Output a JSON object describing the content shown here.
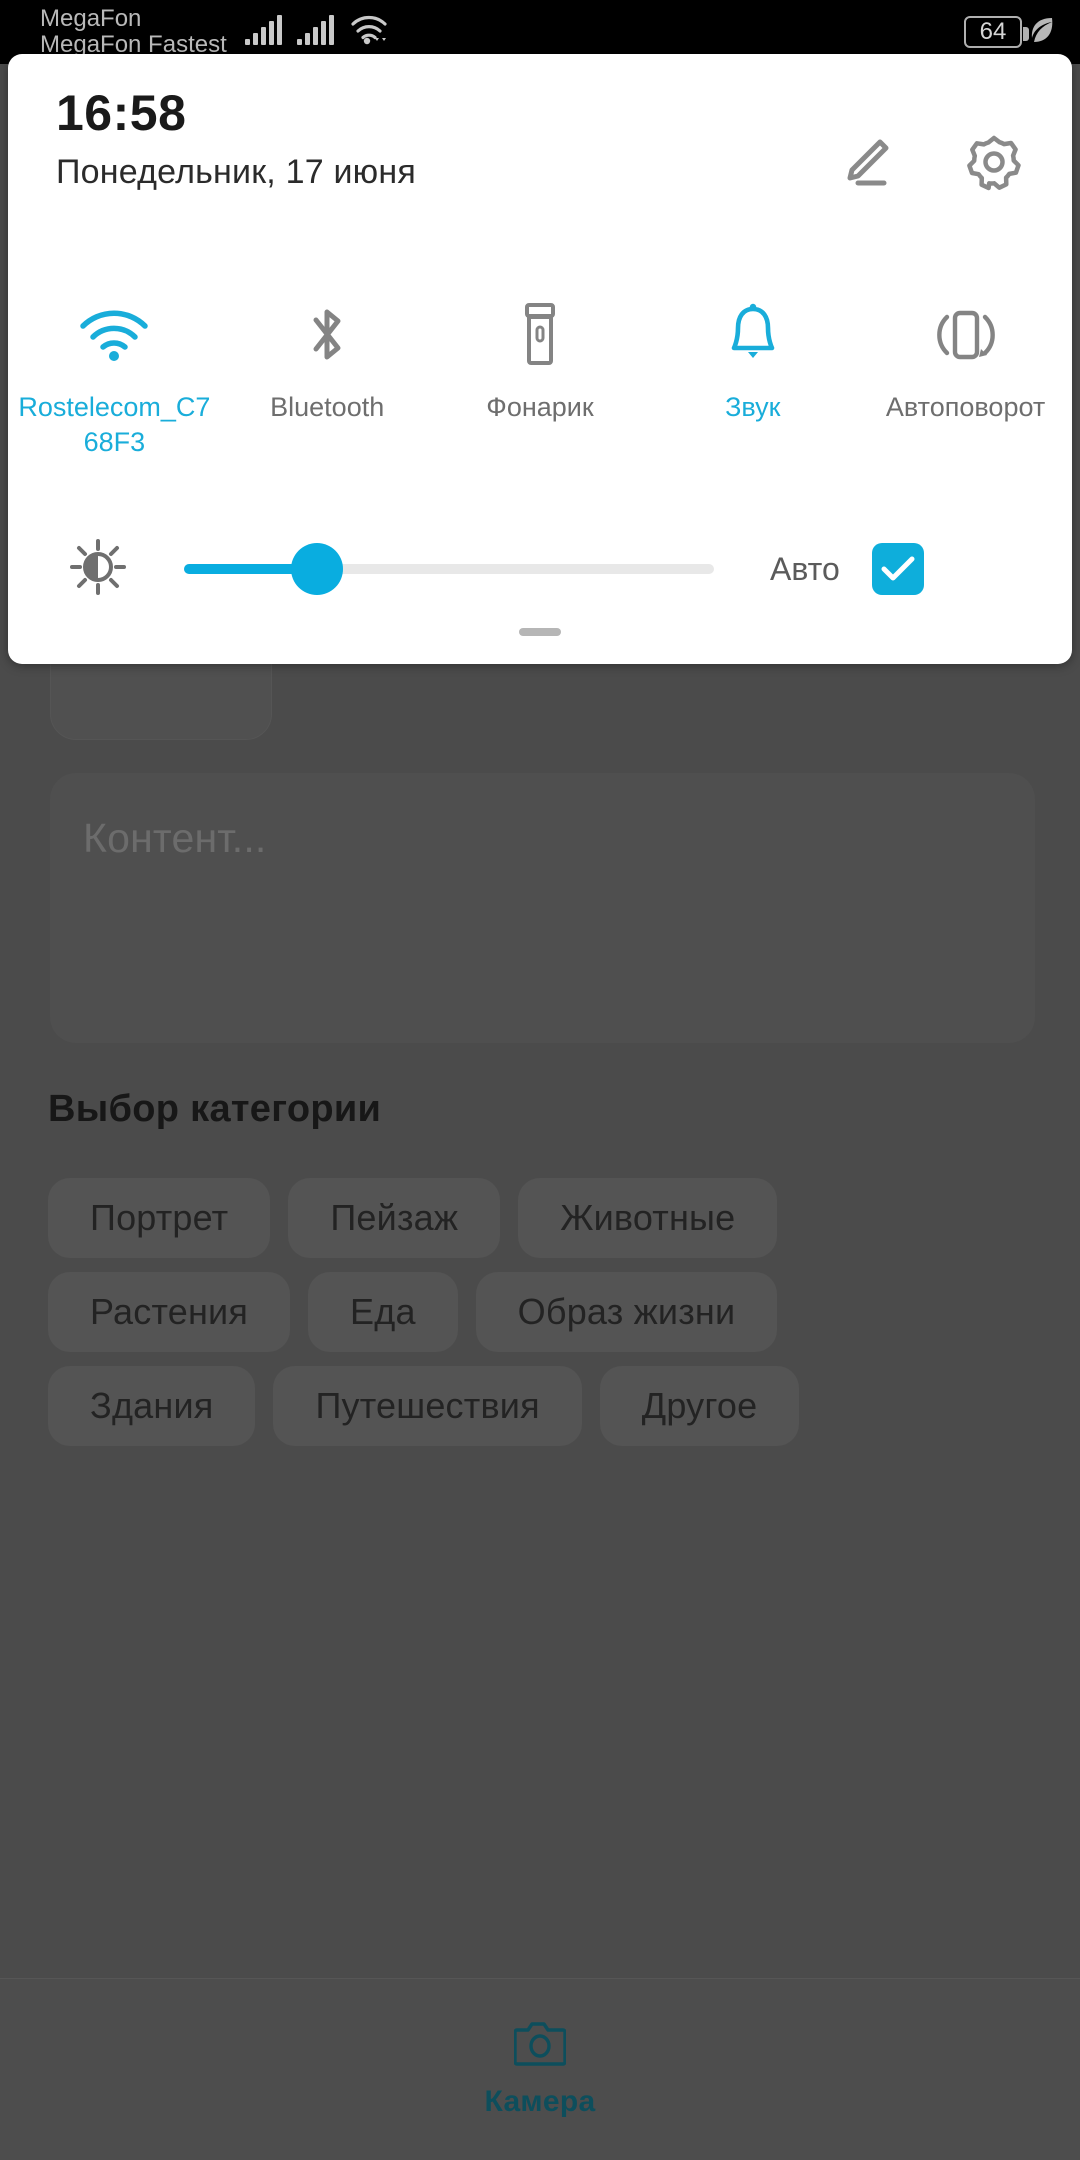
{
  "status_bar": {
    "carrier_line1": "MegaFon",
    "carrier_line2": "MegaFon Fastest",
    "signal_icon_1": "signal-bars-icon",
    "signal_icon_2": "signal-bars-icon",
    "wifi_icon": "wifi-data-icon",
    "battery_level": "64",
    "battery_icon": "battery-icon",
    "power_saving_icon": "leaf-icon"
  },
  "quick_settings": {
    "time": "16:58",
    "date": "Понедельник, 17 июня",
    "edit_icon": "pencil-icon",
    "settings_icon": "gear-icon",
    "accent_color": "#19adda",
    "inactive_color": "#6e6e6e",
    "toggles": [
      {
        "label": "Rostelecom_C768F3",
        "icon": "wifi-icon",
        "active": true
      },
      {
        "label": "Bluetooth",
        "icon": "bluetooth-icon",
        "active": false
      },
      {
        "label": "Фонарик",
        "icon": "flashlight-icon",
        "active": false
      },
      {
        "label": "Звук",
        "icon": "bell-icon",
        "active": true
      },
      {
        "label": "Автоповорот",
        "icon": "auto-rotate-icon",
        "active": false
      }
    ],
    "brightness": {
      "icon": "brightness-sun-icon",
      "value_percent": 25,
      "auto_label": "Авто",
      "auto_checked": true,
      "checkbox_color": "#0eaedb"
    },
    "drag_handle": "drag-handle"
  },
  "app": {
    "content_placeholder": "Контент...",
    "category_section_title": "Выбор категории",
    "category_rows": [
      [
        "Портрет",
        "Пейзаж",
        "Животные"
      ],
      [
        "Растения",
        "Еда",
        "Образ жизни"
      ],
      [
        "Здания",
        "Путешествия",
        "Другое"
      ]
    ],
    "bottom_nav": {
      "label": "Камера",
      "icon": "camera-icon",
      "color": "#0d4e5c"
    }
  }
}
